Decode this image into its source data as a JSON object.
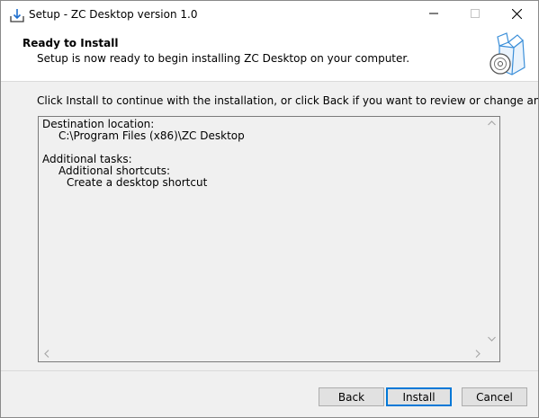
{
  "window": {
    "title": "Setup - ZC Desktop version 1.0",
    "icons": {
      "app": "setup-download-icon",
      "minimize": "minimize-icon",
      "maximize": "maximize-icon",
      "close": "close-icon"
    }
  },
  "header": {
    "title": "Ready to Install",
    "subtitle": "Setup is now ready to begin installing ZC Desktop on your computer.",
    "image": "setup-box-disc-icon"
  },
  "instruction": "Click Install to continue with the installation, or click Back if you want to review or change any settings.",
  "memo": {
    "lines": [
      "Destination location:",
      "C:\\Program Files (x86)\\ZC Desktop",
      "",
      "Additional tasks:",
      "Additional shortcuts:",
      "Create a desktop shortcut"
    ]
  },
  "buttons": {
    "back": "Back",
    "install": "Install",
    "cancel": "Cancel"
  },
  "colors": {
    "accent": "#0078d7",
    "background": "#f0f0f0"
  }
}
